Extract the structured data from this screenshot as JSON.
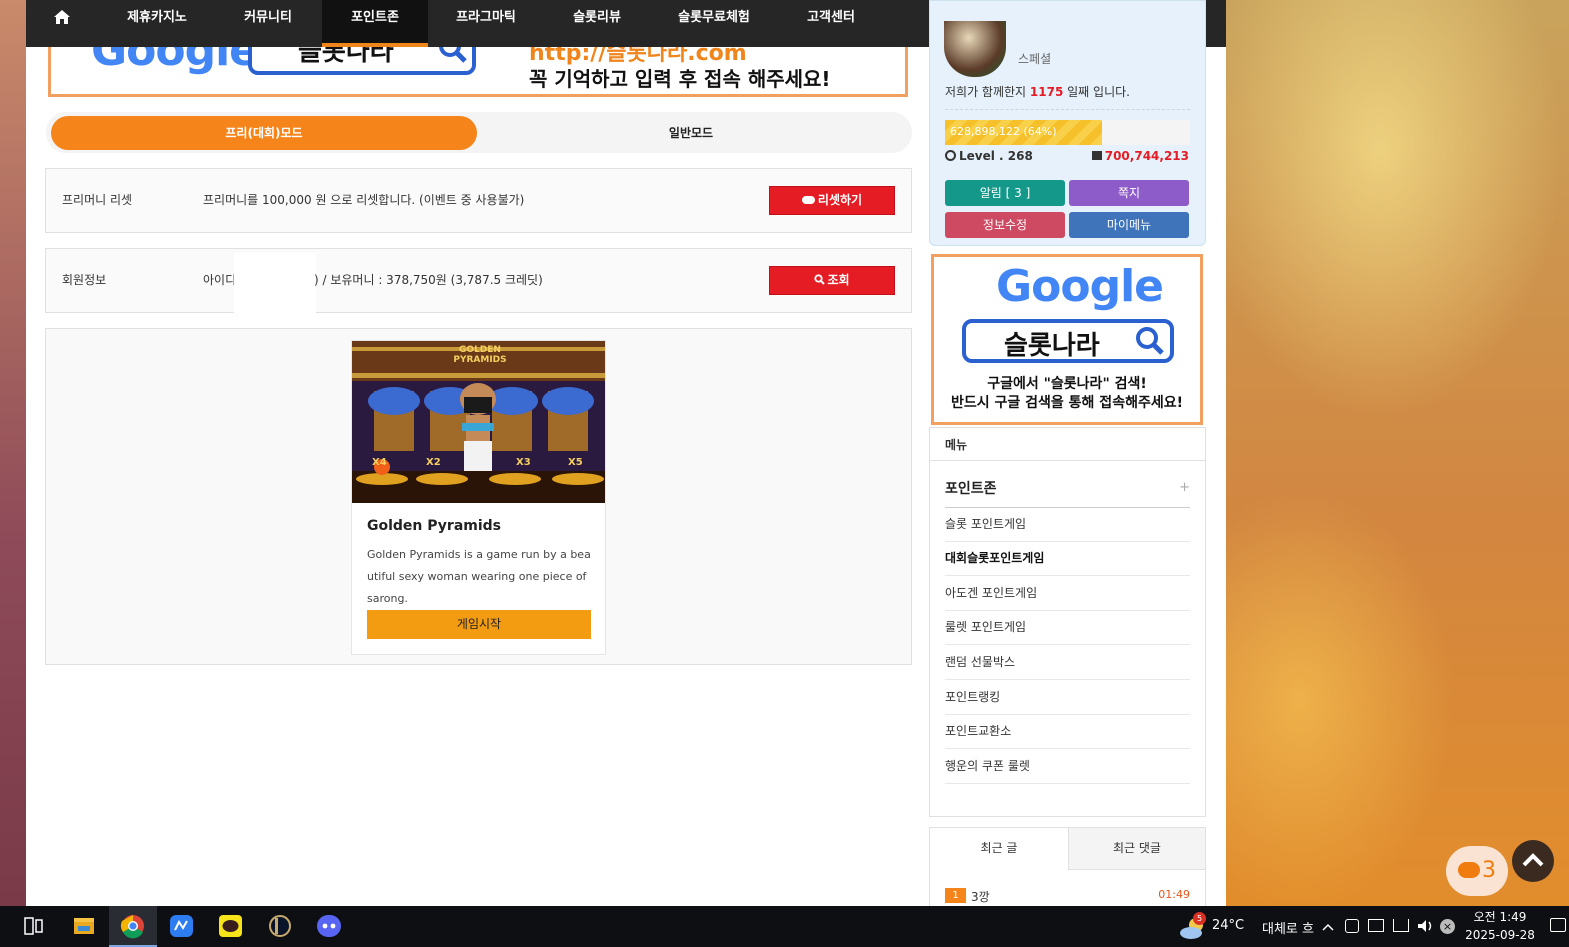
{
  "nav": {
    "items": [
      "제휴카지노",
      "커뮤니티",
      "포인트존",
      "프라그마틱",
      "슬롯리뷰",
      "슬롯무료체험",
      "고객센터"
    ],
    "bell_count": "3"
  },
  "banner": {
    "logo_text": "Google",
    "search_text": "슬롯나라",
    "url_text": "http://슬롯나라.com",
    "message": "꼭 기억하고 입력 후 접속 해주세요!"
  },
  "mode": {
    "free": "프리(대회)모드",
    "normal": "일반모드"
  },
  "reset_row": {
    "label": "프리머니 리셋",
    "desc": "프리머니를 100,000 원 으로 리셋합니다. (이벤트 중 사용불가)",
    "button": "리셋하기"
  },
  "member_row": {
    "label": "회원정보",
    "desc_prefix": "아이디",
    "desc_suffix": ") / 보유머니 : 378,750원 (3,787.5 크레딧)",
    "button": "조회"
  },
  "game": {
    "thumb_title": "GOLDEN PYRAMIDS",
    "multipliers": [
      "X4",
      "X2",
      "X3",
      "X5"
    ],
    "title": "Golden Pyramids",
    "desc": "Golden Pyramids is a game run by a beautiful sexy woman wearing one piece of sarong.",
    "button": "게임시작"
  },
  "user": {
    "grade": "스페셜",
    "days_prefix": "저희가 함께한지 ",
    "days": "1175",
    "days_suffix": " 일째 입니다.",
    "exp_text": "628,898,122 (64%)",
    "exp_percent": 64,
    "level_text": "Level . 268",
    "points": "700,744,213",
    "btn_alarm": "알림 [ 3 ]",
    "btn_memo": "쪽지",
    "btn_edit": "정보수정",
    "btn_mymenu": "마이메뉴"
  },
  "google_ad": {
    "logo": "Google",
    "search": "슬롯나라",
    "line1": "구글에서 \"슬롯나라\" 검색!",
    "line2": "반드시 구글 검색을 통해 접속해주세요!"
  },
  "menu": {
    "header": "메뉴",
    "section": "포인트존",
    "items": [
      "슬롯 포인트게임",
      "대회슬롯포인트게임",
      "아도겐 포인트게임",
      "룰렛 포인트게임",
      "랜덤 선물박스",
      "포인트랭킹",
      "포인트교환소",
      "행운의 쿠폰 룰렛"
    ]
  },
  "recent": {
    "tab_posts": "최근 글",
    "tab_comments": "최근 댓글",
    "item_rank": "1",
    "item_title": "3깡",
    "item_time": "01:49"
  },
  "floating": {
    "chat_count": "3"
  },
  "taskbar": {
    "weather_badge": "5",
    "temperature": "24°C",
    "weather_text": "대체로 흐",
    "time": "오전 1:49",
    "date": "2025-09-28"
  }
}
